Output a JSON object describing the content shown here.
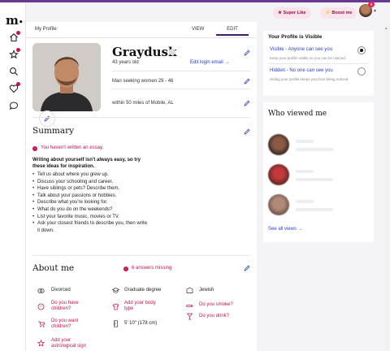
{
  "app": {
    "logo": "m",
    "logo_dot": "•"
  },
  "header": {
    "super_like": "Super Like",
    "boost_me": "Boost me",
    "notif_count": "9"
  },
  "tabs": {
    "title": "My Profile",
    "view": "VIEW",
    "edit": "EDIT"
  },
  "profile": {
    "name": "Graydusk",
    "age": "43 years old",
    "edit_login": "Edit login email →",
    "seeking": "Man seeking women 29 - 46",
    "distance": "within 50 miles of Mobile, AL"
  },
  "summary": {
    "title": "Summary",
    "warning": "You haven't written an essay.",
    "prompt": "Writing about yourself isn't always easy, so try these ideas for inspiration.",
    "ideas": [
      "Tell us about where you grew up.",
      "Discuss your schooling and career.",
      "Have siblings or pets? Describe them.",
      "Talk about your passions or hobbies.",
      "Describe what you're looking for.",
      "What do you do on the weekends?",
      "List your favorite music, movies or TV.",
      "Ask your closest friends to describe you, then write it down."
    ]
  },
  "about": {
    "title": "About me",
    "missing": "6 answers missing",
    "col1": [
      "Divorced",
      "Do you have children?",
      "Do you want children?",
      "Add your astrological sign"
    ],
    "col2": [
      "Graduate degree",
      "Add your body type",
      "5' 10\" (178 cm)"
    ],
    "col3": [
      "Jewish",
      "Do you smoke?",
      "Do you drink?"
    ]
  },
  "visibility": {
    "title": "Your Profile is Visible",
    "visible_label": "Visible - Anyone can see you",
    "visible_desc": "Keep your profile visible so you can be noticed.",
    "hidden_label": "Hidden - No one can see you",
    "hidden_desc": "Hiding your profile keeps you from being noticed."
  },
  "viewers": {
    "title": "Who viewed me",
    "see_all": "See all views →"
  },
  "colors": {
    "accent": "#c4134f",
    "link": "#2b3fd0",
    "brand": "#3a1f66"
  }
}
